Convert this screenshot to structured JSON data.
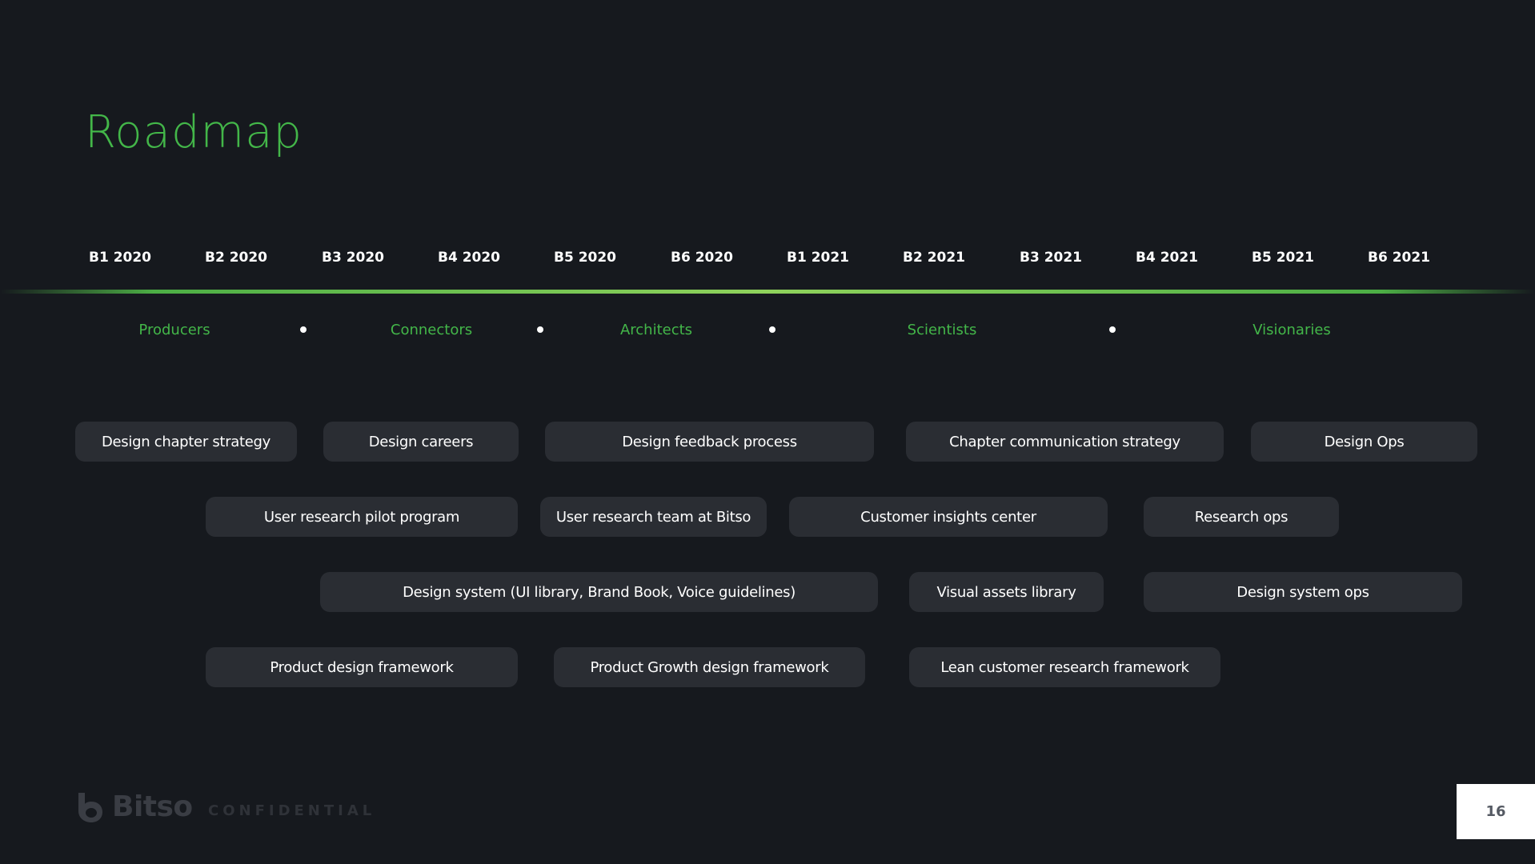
{
  "title": "Roadmap",
  "periods": [
    "B1 2020",
    "B2 2020",
    "B3 2020",
    "B4 2020",
    "B5 2020",
    "B6 2020",
    "B1 2021",
    "B2 2021",
    "B3 2021",
    "B4 2021",
    "B5 2021",
    "B6 2021"
  ],
  "phases": [
    "Producers",
    "Connectors",
    "Architects",
    "Scientists",
    "Visionaries"
  ],
  "rows": [
    [
      "Design chapter strategy",
      "Design careers",
      "Design feedback process",
      "Chapter communication strategy",
      "Design Ops"
    ],
    [
      "User research pilot program",
      "User research team at Bitso",
      "Customer insights center",
      "Research ops"
    ],
    [
      "Design system (UI library, Brand Book, Voice guidelines)",
      "Visual assets library",
      "Design system ops"
    ],
    [
      "Product design framework",
      "Product Growth design framework",
      "Lean customer research framework"
    ]
  ],
  "footer": {
    "brand": "Bitso",
    "label": "CONFIDENTIAL",
    "page": "16"
  },
  "colors": {
    "background": "#16191e",
    "accent": "#43b649",
    "pill": "#2a2d33",
    "text": "#ffffff"
  }
}
